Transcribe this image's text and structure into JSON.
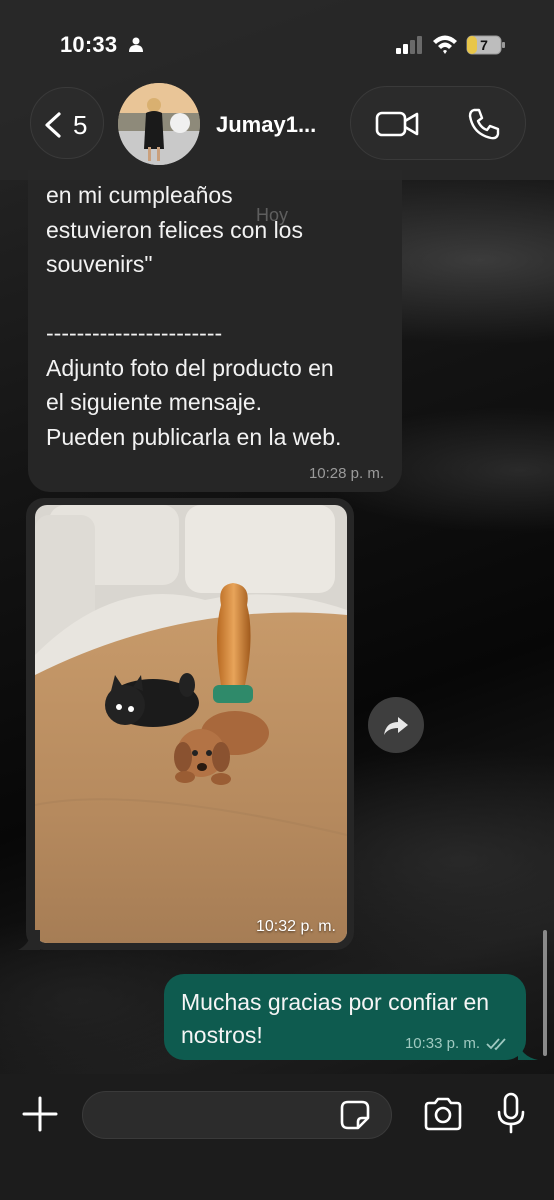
{
  "status_bar": {
    "time": "10:33",
    "battery": "7"
  },
  "header": {
    "back_count": "5",
    "contact_name": "Jumay1..."
  },
  "messages": {
    "date_label": "Hoy",
    "incoming_text": "en mi cumpleaños\nestuvieron felices con los\nsouvenirs\"\n\n-----------------------\nAdjunto foto del producto en\nel siguiente mensaje.\nPueden publicarla en la web.",
    "incoming_time": "10:28 p. m.",
    "photo_time": "10:32 p. m.",
    "outgoing_text": "Muchas gracias por confiar en nostros!",
    "outgoing_time": "10:33 p. m.",
    "outgoing_status": "read"
  },
  "input_bar": {
    "placeholder": ""
  },
  "colors": {
    "incoming_bubble": "#262626",
    "outgoing_bubble": "#0e5b4f",
    "read_check": "#9fc9c0"
  },
  "icons": [
    "person-icon",
    "signal-icon",
    "wifi-icon",
    "battery-icon",
    "chevron-left-icon",
    "video-camera-icon",
    "phone-icon",
    "forward-icon",
    "double-check-icon",
    "plus-icon",
    "sticker-icon",
    "camera-icon",
    "microphone-icon"
  ]
}
